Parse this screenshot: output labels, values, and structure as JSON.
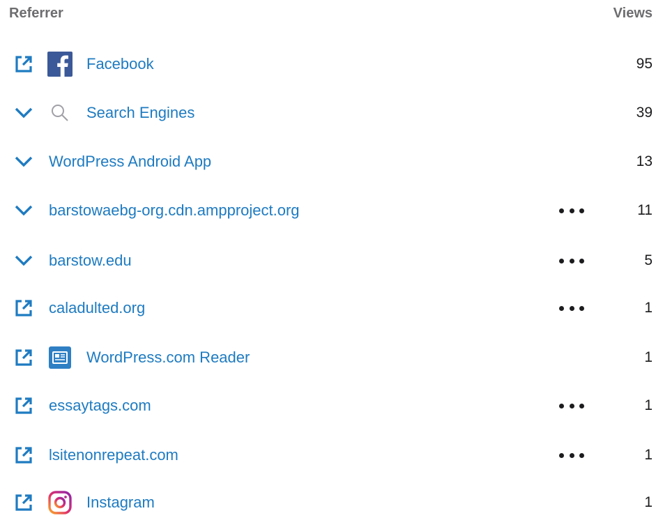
{
  "header": {
    "referrer_label": "Referrer",
    "views_label": "Views"
  },
  "colors": {
    "link": "#1e7bc1",
    "header_text": "#6d6d70",
    "value_text": "#1c1c1e",
    "facebook": "#3b5998",
    "reader": "#2e7fc4"
  },
  "rows": [
    {
      "label": "Facebook",
      "value": "95",
      "action": "external-link-icon",
      "icon": "facebook-icon",
      "more": false
    },
    {
      "label": "Search Engines",
      "value": "39",
      "action": "chevron-down-icon",
      "icon": "search-icon",
      "more": false
    },
    {
      "label": "WordPress Android App",
      "value": "13",
      "action": "chevron-down-icon",
      "icon": "",
      "more": false
    },
    {
      "label": "barstowaebg-org.cdn.ampproject.org",
      "value": "11",
      "action": "chevron-down-icon",
      "icon": "",
      "more": true
    },
    {
      "label": "barstow.edu",
      "value": "5",
      "action": "chevron-down-icon",
      "icon": "",
      "more": true
    },
    {
      "label": "caladulted.org",
      "value": "1",
      "action": "external-link-icon",
      "icon": "",
      "more": true
    },
    {
      "label": "WordPress.com Reader",
      "value": "1",
      "action": "external-link-icon",
      "icon": "reader-icon",
      "more": false
    },
    {
      "label": "essaytags.com",
      "value": "1",
      "action": "external-link-icon",
      "icon": "",
      "more": true
    },
    {
      "label": "lsitenonrepeat.com",
      "value": "1",
      "action": "external-link-icon",
      "icon": "",
      "more": true
    },
    {
      "label": "Instagram",
      "value": "1",
      "action": "external-link-icon",
      "icon": "instagram-icon",
      "more": false
    }
  ]
}
